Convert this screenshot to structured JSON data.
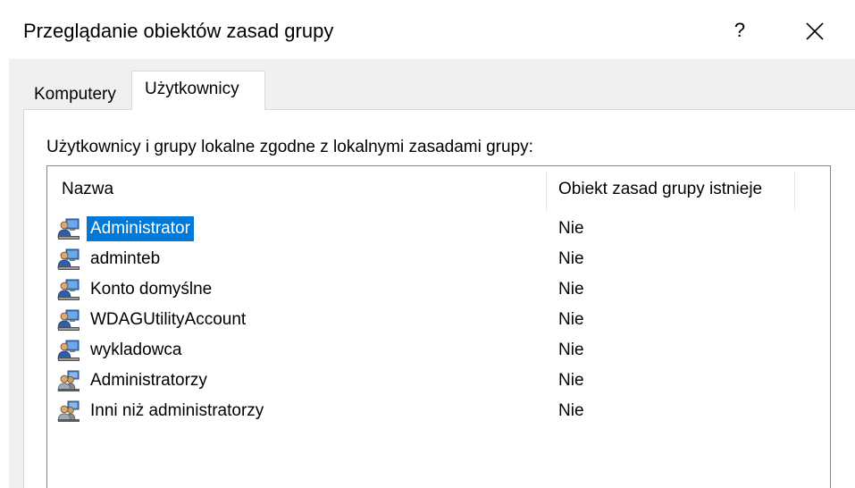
{
  "window": {
    "title": "Przeglądanie obiektów zasad grupy",
    "help_label": "?"
  },
  "tabs": [
    {
      "label": "Komputery",
      "active": false
    },
    {
      "label": "Użytkownicy",
      "active": true
    }
  ],
  "panel": {
    "description": "Użytkownicy i grupy lokalne zgodne z lokalnymi zasadami grupy:"
  },
  "table": {
    "columns": [
      "Nazwa",
      "Obiekt zasad grupy istnieje"
    ],
    "rows": [
      {
        "name": "Administrator",
        "exists": "Nie",
        "icon": "user-icon",
        "selected": true
      },
      {
        "name": "adminteb",
        "exists": "Nie",
        "icon": "user-icon",
        "selected": false
      },
      {
        "name": "Konto domyślne",
        "exists": "Nie",
        "icon": "user-icon",
        "selected": false
      },
      {
        "name": "WDAGUtilityAccount",
        "exists": "Nie",
        "icon": "user-icon",
        "selected": false
      },
      {
        "name": "wykladowca",
        "exists": "Nie",
        "icon": "user-icon",
        "selected": false
      },
      {
        "name": "Administratorzy",
        "exists": "Nie",
        "icon": "group-icon",
        "selected": false
      },
      {
        "name": "Inni niż administratorzy",
        "exists": "Nie",
        "icon": "group-icon",
        "selected": false
      }
    ]
  },
  "colors": {
    "selection": "#0078d7",
    "dialog_background": "#f0f0f0",
    "list_border": "#828790"
  }
}
